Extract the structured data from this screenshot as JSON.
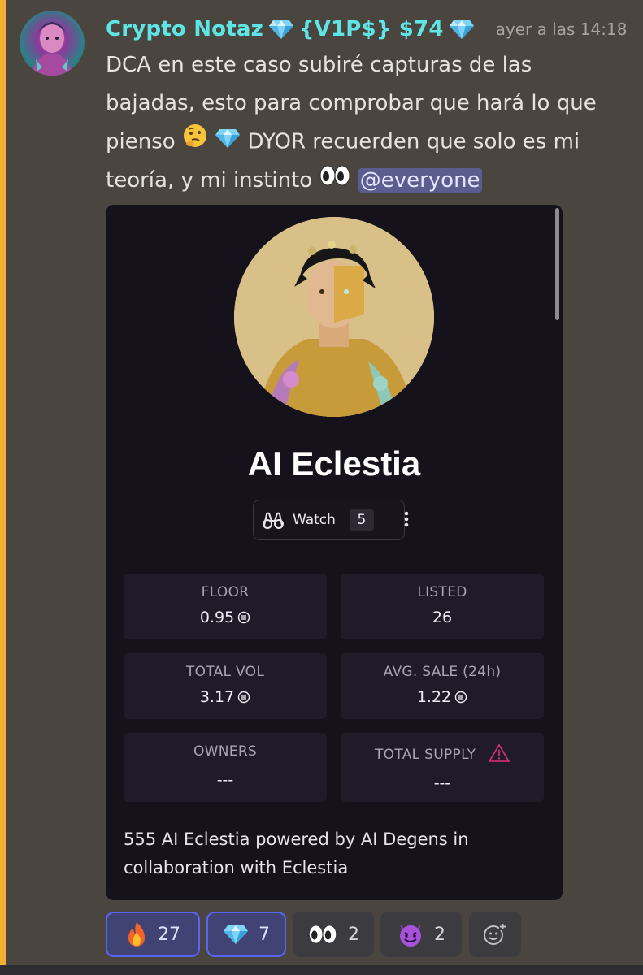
{
  "author": {
    "username": "Crypto Notaz",
    "tag": "{V1P$} $74",
    "timestamp": "ayer a las 14:18"
  },
  "message": {
    "text_1": "DCA en este caso subiré capturas de las bajadas, esto para comprobar que hará lo que pienso",
    "text_2": "DYOR recuerden que solo es mi teoría, y mi instinto",
    "mention": "@everyone"
  },
  "embed": {
    "title": "AI Eclestia",
    "watch": {
      "label": "Watch",
      "count": "5"
    },
    "stats": [
      {
        "label": "FLOOR",
        "value": "0.95",
        "currency_icon": true
      },
      {
        "label": "LISTED",
        "value": "26",
        "currency_icon": false
      },
      {
        "label": "TOTAL VOL",
        "value": "3.17",
        "currency_icon": true
      },
      {
        "label": "AVG. SALE (24h)",
        "value": "1.22",
        "currency_icon": true
      },
      {
        "label": "OWNERS",
        "value": "---",
        "currency_icon": false
      },
      {
        "label": "TOTAL SUPPLY",
        "value": "---",
        "currency_icon": false,
        "warning_icon": true
      }
    ],
    "description": "555 AI Eclestia powered by AI Degens in collaboration with Eclestia"
  },
  "reactions": [
    {
      "emoji": "fire",
      "count": "27",
      "active": true
    },
    {
      "emoji": "gem",
      "count": "7",
      "active": true
    },
    {
      "emoji": "eyes",
      "count": "2",
      "active": false
    },
    {
      "emoji": "smiling-imp",
      "count": "2",
      "active": false
    }
  ],
  "colors": {
    "username": "#5ee6e6",
    "mention_bar": "#f0b132",
    "mention_bg": "#5b5d8e",
    "active_reaction_border": "#5865f2",
    "background": "#4a463f",
    "embed_bg": "#15121b",
    "warning": "#e0307a"
  }
}
